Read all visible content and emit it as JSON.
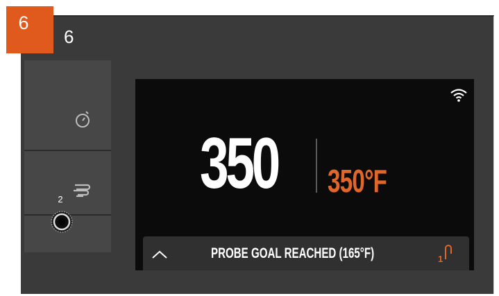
{
  "step": {
    "badge_label": "6",
    "title": "6"
  },
  "controls": {
    "timer_icon": "stopwatch-icon",
    "fan_icon": "smoke-fan-icon",
    "probe_port_label": "2",
    "probe_port_icon": "probe-port-icon"
  },
  "screen": {
    "wifi_icon": "wifi-icon",
    "actual_temp": "350",
    "set_temp": "350°F",
    "status_message": "PROBE GOAL REACHED (165°F)",
    "chevron_icon": "chevron-up-icon",
    "probe_indicator_icon": "probe-1-icon",
    "probe_indicator_number": "1"
  },
  "colors": {
    "badge": "#e05a1e",
    "set_temp": "#e0662a",
    "screen_bg": "#0b0b0b",
    "housing_bg": "#3a3a3a"
  }
}
